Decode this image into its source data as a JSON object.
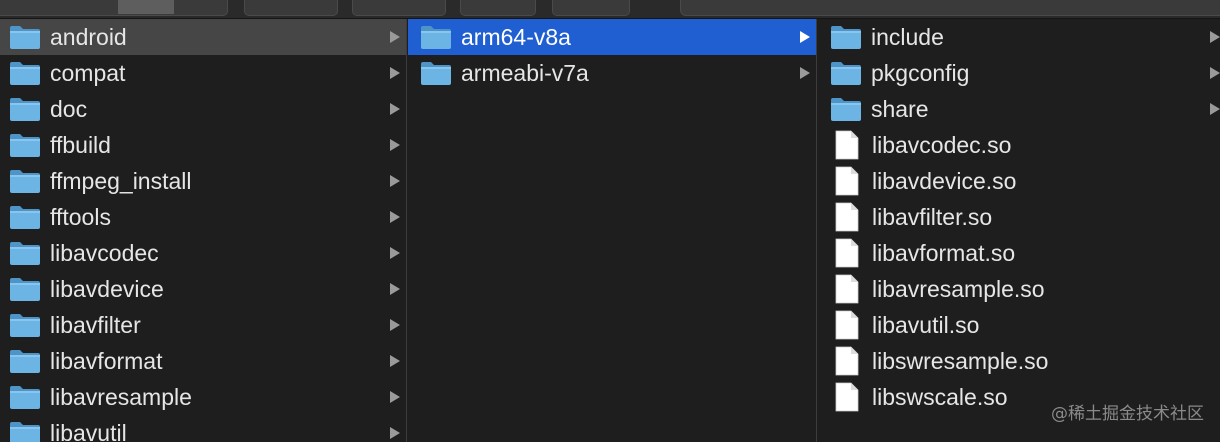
{
  "columns": {
    "root": [
      {
        "label": "android",
        "kind": "folder",
        "selected": "grey"
      },
      {
        "label": "compat",
        "kind": "folder"
      },
      {
        "label": "doc",
        "kind": "folder"
      },
      {
        "label": "ffbuild",
        "kind": "folder"
      },
      {
        "label": "ffmpeg_install",
        "kind": "folder"
      },
      {
        "label": "fftools",
        "kind": "folder"
      },
      {
        "label": "libavcodec",
        "kind": "folder"
      },
      {
        "label": "libavdevice",
        "kind": "folder"
      },
      {
        "label": "libavfilter",
        "kind": "folder"
      },
      {
        "label": "libavformat",
        "kind": "folder"
      },
      {
        "label": "libavresample",
        "kind": "folder"
      },
      {
        "label": "libavutil",
        "kind": "folder"
      }
    ],
    "android": [
      {
        "label": "arm64-v8a",
        "kind": "folder",
        "selected": "blue"
      },
      {
        "label": "armeabi-v7a",
        "kind": "folder"
      }
    ],
    "arm64": [
      {
        "label": "include",
        "kind": "folder"
      },
      {
        "label": "pkgconfig",
        "kind": "folder"
      },
      {
        "label": "share",
        "kind": "folder"
      },
      {
        "label": "libavcodec.so",
        "kind": "file"
      },
      {
        "label": "libavdevice.so",
        "kind": "file"
      },
      {
        "label": "libavfilter.so",
        "kind": "file"
      },
      {
        "label": "libavformat.so",
        "kind": "file"
      },
      {
        "label": "libavresample.so",
        "kind": "file"
      },
      {
        "label": "libavutil.so",
        "kind": "file"
      },
      {
        "label": "libswresample.so",
        "kind": "file"
      },
      {
        "label": "libswscale.so",
        "kind": "file"
      }
    ]
  },
  "watermark": "@稀土掘金技术社区",
  "colors": {
    "selection_blue": "#1f5fd2",
    "folder_blue": "#6cb4e4"
  }
}
